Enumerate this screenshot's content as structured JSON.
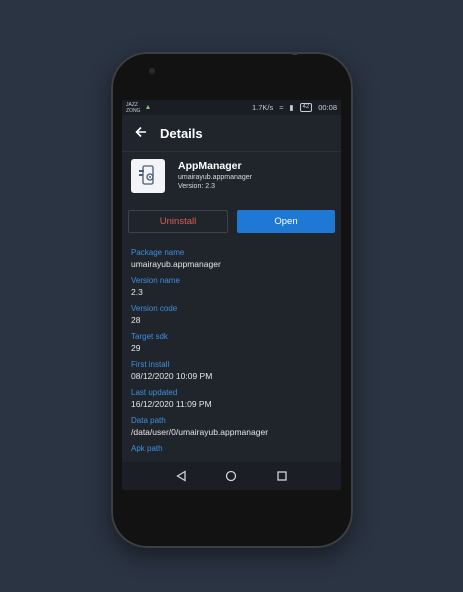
{
  "status_bar": {
    "carrier_line1": "JAZZ",
    "carrier_line2": "ZONG",
    "speed": "1.7K/s",
    "battery": "42",
    "time": "00:08"
  },
  "appbar": {
    "title": "Details"
  },
  "app": {
    "name": "AppManager",
    "package": "umairayub.appmanager",
    "version": "Version: 2.3"
  },
  "buttons": {
    "uninstall": "Uninstall",
    "open": "Open"
  },
  "details": [
    {
      "label": "Package name",
      "value": "umairayub.appmanager"
    },
    {
      "label": "Version name",
      "value": "2.3"
    },
    {
      "label": "Version code",
      "value": "28"
    },
    {
      "label": "Target sdk",
      "value": "29"
    },
    {
      "label": "First install",
      "value": "08/12/2020 10:09 PM"
    },
    {
      "label": "Last updated",
      "value": "16/12/2020 11:09 PM"
    },
    {
      "label": "Data path",
      "value": "/data/user/0/umairayub.appmanager"
    },
    {
      "label": "Apk path",
      "value": ""
    }
  ],
  "colors": {
    "background": "#2b3443",
    "screen": "#20252c",
    "accent": "#1e78d4",
    "label": "#3d8fe0",
    "danger": "#e05a57"
  },
  "icons": [
    "back-arrow-icon",
    "app-settings-icon",
    "nav-back-icon",
    "nav-home-icon",
    "nav-recents-icon"
  ]
}
